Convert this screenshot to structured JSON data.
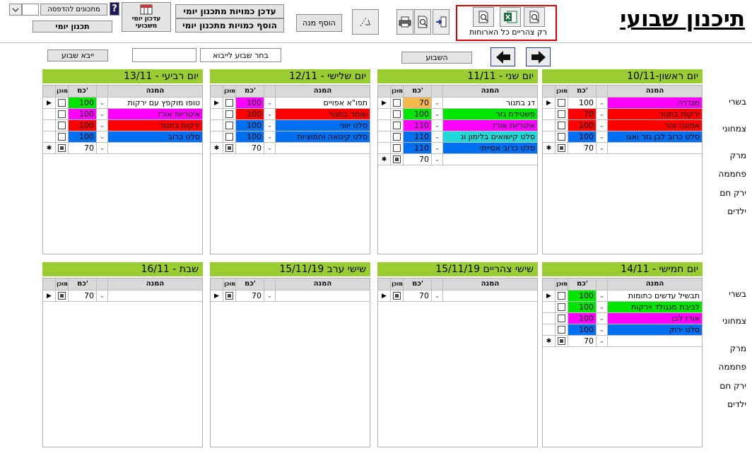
{
  "app": {
    "title": "תיכנון שבועי"
  },
  "toolbar": {
    "print_ready_label": "מתכונים להדפסה",
    "daily_plan_label": "תכנון יומי",
    "weekly_update_line1": "עדכון יומי",
    "weekly_update_line2": "משבועי",
    "update_qty_label": "עדכן כמויות מתכנון יומי",
    "add_qty_label": "הוסף כמויות מתכנון יומי",
    "add_dish_label": "הוסף מנה",
    "export_caption": "רק צהריים כל הארוחות",
    "help_glyph": "?"
  },
  "weeknav": {
    "this_week_label": "השבוע",
    "choose_week_label": "בחר שבוע לייבוא",
    "import_week_label": "ייבא שבוע",
    "week_input_value": ""
  },
  "row_labels": [
    "בשרי",
    "צמחוני",
    "מרק",
    "פחממה",
    "ירק חם",
    "ילדים"
  ],
  "grid_headers": {
    "dish": "המנה",
    "qty": "כמ'",
    "ready": "מוכן"
  },
  "colors": {
    "day_header": "#9acd32",
    "orange": "#f4b94c",
    "green": "#00e600",
    "red": "#ff0000",
    "magenta": "#ff00ff",
    "blue": "#0070f0",
    "cyan": "#20d8d8",
    "red_frame": "#e00000"
  },
  "days": [
    {
      "id": "sun",
      "header": "יום ראשון-10/11",
      "rows": [
        {
          "dish": "מגדרה",
          "qty": "100",
          "color": "magenta",
          "qtyColor": "white"
        },
        {
          "dish": "ירקות בתנור",
          "qty": "70",
          "color": "red",
          "qtyColor": "red"
        },
        {
          "dish": "אפונה וגזר",
          "qty": "100",
          "color": "red",
          "qtyColor": "red"
        },
        {
          "dish": "סלט כרוב לבן גזר ואגו",
          "qty": "100",
          "color": "blue",
          "qtyColor": "blue"
        }
      ],
      "new_qty": "70"
    },
    {
      "id": "mon",
      "header": "יום שני - 11/11",
      "rows": [
        {
          "dish": "דג בתנור",
          "qty": "70",
          "color": "white",
          "qtyColor": "orange"
        },
        {
          "dish": "פשטידת גזר",
          "qty": "100",
          "color": "green",
          "qtyColor": "green"
        },
        {
          "dish": "איטריות אורז",
          "qty": "110",
          "color": "magenta",
          "qtyColor": "magenta"
        },
        {
          "dish": "סלט קישואים בלימון ונ",
          "qty": "110",
          "color": "cyan",
          "qtyColor": "blue"
        },
        {
          "dish": "סלט כרוב אסייתי",
          "qty": "110",
          "color": "blue",
          "qtyColor": "blue"
        }
      ],
      "new_qty": "70"
    },
    {
      "id": "tue",
      "header": "יום שלישי - 12/11",
      "rows": [
        {
          "dish": "תפו\"א אפויים",
          "qty": "100",
          "color": "white",
          "qtyColor": "magenta"
        },
        {
          "dish": "שומר בתנור",
          "qty": "100",
          "color": "red",
          "qtyColor": "red"
        },
        {
          "dish": "סלט יווני",
          "qty": "100",
          "color": "blue",
          "qtyColor": "blue"
        },
        {
          "dish": "סלט קינואה וחמוציות",
          "qty": "100",
          "color": "blue",
          "qtyColor": "blue"
        }
      ],
      "new_qty": "70"
    },
    {
      "id": "wed",
      "header": "יום רביעי - 13/11",
      "rows": [
        {
          "dish": "טופו מוקפץ עם ירקות",
          "qty": "100",
          "color": "white",
          "qtyColor": "green"
        },
        {
          "dish": "איטריות אורז",
          "qty": "100",
          "color": "magenta",
          "qtyColor": "magenta"
        },
        {
          "dish": "ירקות בתנור",
          "qty": "100",
          "color": "red",
          "qtyColor": "red"
        },
        {
          "dish": "סלט כרוב",
          "qty": "100",
          "color": "blue",
          "qtyColor": "blue"
        }
      ],
      "new_qty": "70"
    },
    {
      "id": "thu",
      "header": "יום חמישי - 14/11",
      "rows": [
        {
          "dish": "תבשיל עדשים כתומות",
          "qty": "100",
          "color": "white",
          "qtyColor": "green"
        },
        {
          "dish": "לביבת מנגולד וירקות",
          "qty": "100",
          "color": "green",
          "qtyColor": "green"
        },
        {
          "dish": "אורז לבן",
          "qty": "100",
          "color": "magenta",
          "qtyColor": "magenta"
        },
        {
          "dish": "סלט ירוק",
          "qty": "100",
          "color": "blue",
          "qtyColor": "blue"
        }
      ],
      "new_qty": "70"
    },
    {
      "id": "frilunch",
      "header": "שישי צהריים     15/11/19",
      "rows": [],
      "new_qty": "70"
    },
    {
      "id": "frieve",
      "header": "שישי ערב     15/11/19",
      "rows": [],
      "new_qty": "70"
    },
    {
      "id": "sat",
      "header": "שבת - 16/11",
      "rows": [],
      "new_qty": "70"
    }
  ]
}
